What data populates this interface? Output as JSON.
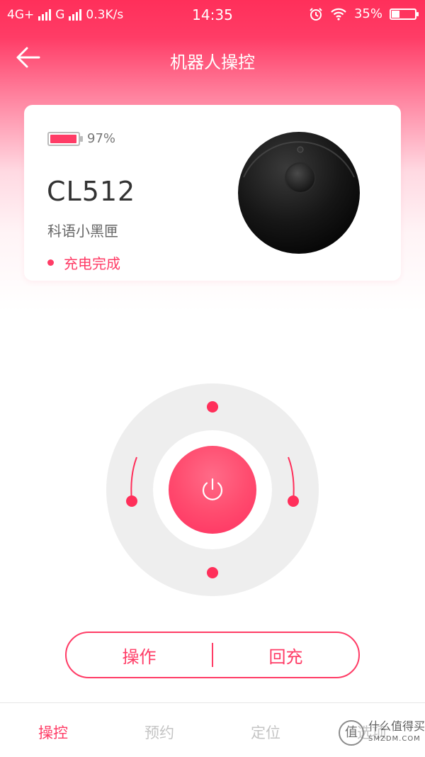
{
  "status_bar": {
    "network_1": "4G+",
    "network_2": "G",
    "speed": "0.3K/s",
    "time": "14:35",
    "battery": "35%",
    "battery_level": 0.35
  },
  "header": {
    "title": "机器人操控",
    "back_icon": "arrow-left-icon"
  },
  "device": {
    "battery_percent_text": "97%",
    "battery_level": 0.97,
    "model": "CL512",
    "name": "科语小黑匣",
    "status": "充电完成",
    "accent": "#ff3c66"
  },
  "controller": {
    "power_icon": "power-icon"
  },
  "actions": {
    "operate": "操作",
    "recharge": "回充"
  },
  "tabs": [
    {
      "label": "操控",
      "active": true
    },
    {
      "label": "预约",
      "active": false
    },
    {
      "label": "定位",
      "active": false
    },
    {
      "label": "选项",
      "active": false
    }
  ],
  "watermark": {
    "mark": "值",
    "text": "什么值得买",
    "sub": "SMZDM.COM"
  }
}
